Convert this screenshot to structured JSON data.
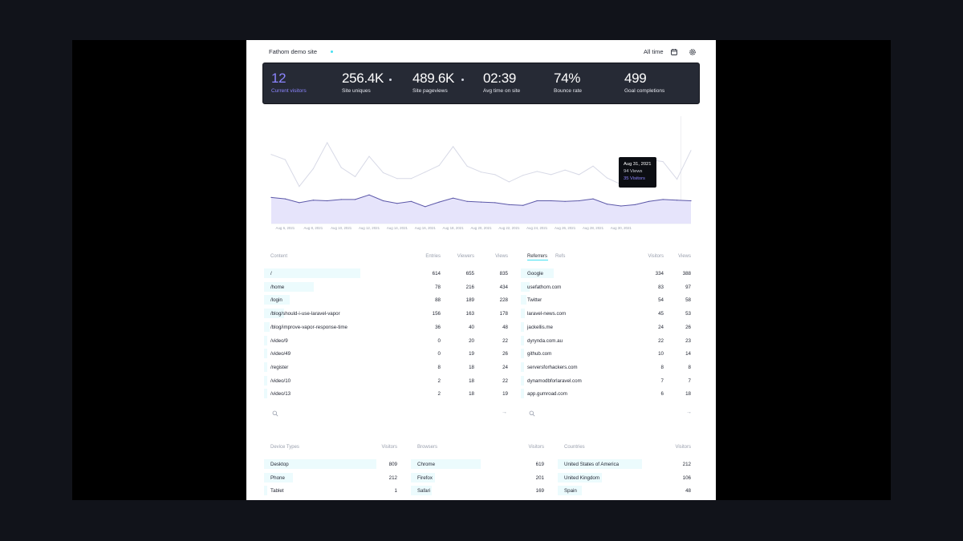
{
  "header": {
    "site_name": "Fathom demo site",
    "range_label": "All time",
    "calendar_icon": "calendar-icon",
    "settings_icon": "gear-icon"
  },
  "stats": [
    {
      "value": "12",
      "label": "Current visitors"
    },
    {
      "value": "256.4K",
      "label": "Site uniques"
    },
    {
      "value": "489.6K",
      "label": "Site pageviews"
    },
    {
      "value": "02:39",
      "label": "Avg time on site"
    },
    {
      "value": "74%",
      "label": "Bounce rate"
    },
    {
      "value": "499",
      "label": "Goal completions"
    }
  ],
  "colors": {
    "accent": "#8c85ff",
    "cyan": "#46e0f2",
    "stats_bg": "#262a35",
    "bar_bg": "#ecfbfd"
  },
  "chart_data": {
    "type": "area",
    "x_tick_labels": [
      "Aug 6, 2021",
      "Aug 8, 2021",
      "Aug 10, 2021",
      "Aug 12, 2021",
      "Aug 14, 2021",
      "Aug 16, 2021",
      "Aug 18, 2021",
      "Aug 20, 2021",
      "Aug 22, 2021",
      "Aug 24, 2021",
      "Aug 26, 2021",
      "Aug 28, 2021",
      "Aug 30, 2021"
    ],
    "series": [
      {
        "name": "Views",
        "values": [
          106,
          98,
          57,
          84,
          124,
          86,
          72,
          103,
          78,
          69,
          69,
          79,
          89,
          118,
          88,
          79,
          75,
          64,
          74,
          80,
          75,
          82,
          75,
          88,
          70,
          60,
          77,
          98,
          95,
          68,
          112
        ]
      },
      {
        "name": "Visitors",
        "values": [
          40,
          38,
          32,
          36,
          35,
          37,
          37,
          44,
          35,
          31,
          34,
          26,
          33,
          39,
          34,
          33,
          32,
          29,
          28,
          35,
          35,
          34,
          35,
          38,
          30,
          27,
          29,
          34,
          37,
          36,
          35
        ]
      }
    ],
    "tooltip": {
      "date": "Aug 31, 2021",
      "views": "94 Views",
      "visitors": "35 Visitors"
    }
  },
  "content": {
    "headers": {
      "name": "Content",
      "entries": "Entries",
      "viewers": "Viewers",
      "views": "Views"
    },
    "rows": [
      {
        "path": "/",
        "entries": "614",
        "viewers": "655",
        "views": "835",
        "share": 1.0
      },
      {
        "path": "/home",
        "entries": "78",
        "viewers": "216",
        "views": "434",
        "share": 0.52
      },
      {
        "path": "/login",
        "entries": "88",
        "viewers": "189",
        "views": "228",
        "share": 0.27
      },
      {
        "path": "/blog/should-i-use-laravel-vapor",
        "entries": "156",
        "viewers": "163",
        "views": "178",
        "share": 0.21
      },
      {
        "path": "/blog/improve-vapor-response-time",
        "entries": "36",
        "viewers": "40",
        "views": "48",
        "share": 0.06
      },
      {
        "path": "/video/9",
        "entries": "0",
        "viewers": "20",
        "views": "22",
        "share": 0.03
      },
      {
        "path": "/video/49",
        "entries": "0",
        "viewers": "19",
        "views": "26",
        "share": 0.03
      },
      {
        "path": "/register",
        "entries": "8",
        "viewers": "18",
        "views": "24",
        "share": 0.03
      },
      {
        "path": "/video/10",
        "entries": "2",
        "viewers": "18",
        "views": "22",
        "share": 0.03
      },
      {
        "path": "/video/13",
        "entries": "2",
        "viewers": "18",
        "views": "19",
        "share": 0.02
      }
    ]
  },
  "referrers": {
    "tabs": {
      "referrers": "Referrers",
      "refs": "Refs"
    },
    "headers": {
      "visitors": "Visitors",
      "views": "Views"
    },
    "rows": [
      {
        "name": "Google",
        "visitors": "334",
        "views": "388",
        "share": 0.3
      },
      {
        "name": "usefathom.com",
        "visitors": "83",
        "views": "97",
        "share": 0.08
      },
      {
        "name": "Twitter",
        "visitors": "54",
        "views": "58",
        "share": 0.05
      },
      {
        "name": "laravel-news.com",
        "visitors": "45",
        "views": "53",
        "share": 0.04
      },
      {
        "name": "jackellis.me",
        "visitors": "24",
        "views": "26",
        "share": 0.02
      },
      {
        "name": "dyrynda.com.au",
        "visitors": "22",
        "views": "23",
        "share": 0.02
      },
      {
        "name": "github.com",
        "visitors": "10",
        "views": "14",
        "share": 0.01
      },
      {
        "name": "serversforhackers.com",
        "visitors": "8",
        "views": "8",
        "share": 0.01
      },
      {
        "name": "dynamodbforlaravel.com",
        "visitors": "7",
        "views": "7",
        "share": 0.01
      },
      {
        "name": "app.gumroad.com",
        "visitors": "6",
        "views": "18",
        "share": 0.01
      }
    ]
  },
  "devices": {
    "headers": {
      "name": "Device Types",
      "visitors": "Visitors"
    },
    "rows": [
      {
        "name": "Desktop",
        "visitors": "809",
        "share": 0.78
      },
      {
        "name": "Phone",
        "visitors": "212",
        "share": 0.2
      },
      {
        "name": "Tablet",
        "visitors": "1",
        "share": 0.01
      }
    ]
  },
  "browsers": {
    "headers": {
      "name": "Browsers",
      "visitors": "Visitors"
    },
    "rows": [
      {
        "name": "Chrome",
        "visitors": "619",
        "share": 0.6
      },
      {
        "name": "Firefox",
        "visitors": "201",
        "share": 0.21
      },
      {
        "name": "Safari",
        "visitors": "169",
        "share": 0.18
      }
    ]
  },
  "countries": {
    "headers": {
      "name": "Countries",
      "visitors": "Visitors"
    },
    "rows": [
      {
        "name": "United States of America",
        "visitors": "212"
      },
      {
        "name": "United Kingdom",
        "visitors": "106"
      },
      {
        "name": "Spain",
        "visitors": "48"
      }
    ]
  },
  "search_icon": "search-icon",
  "arrow_glyph": "→"
}
